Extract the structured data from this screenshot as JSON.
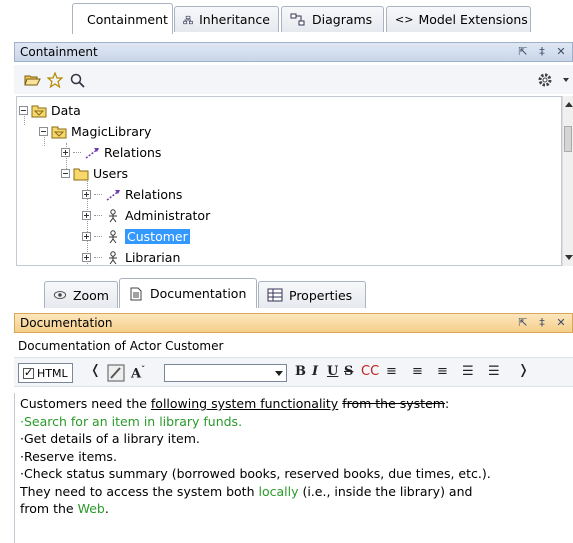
{
  "top_tabs": [
    {
      "label": "Containment",
      "icon": "containment-tree-icon",
      "active": true
    },
    {
      "label": "Inheritance",
      "icon": "inheritance-tree-icon",
      "active": false
    },
    {
      "label": "Diagrams",
      "icon": "diagrams-icon",
      "active": false
    },
    {
      "label": "Model Extensions",
      "icon": "model-extensions-icon",
      "active": false
    }
  ],
  "containment_panel": {
    "title": "Containment",
    "controls": [
      "restore-icon",
      "pin-icon",
      "close-icon"
    ]
  },
  "containment_toolbar": [
    "open-folder-icon",
    "favorite-star-icon",
    "search-icon",
    "settings-gear-icon"
  ],
  "tree": [
    {
      "label": "Data",
      "level": 0,
      "icon": "package-icon",
      "expanded": true
    },
    {
      "label": "MagicLibrary",
      "level": 1,
      "icon": "package-icon",
      "expanded": true
    },
    {
      "label": "Relations",
      "level": 2,
      "icon": "relations-icon",
      "expanded": false
    },
    {
      "label": "Users",
      "level": 2,
      "icon": "folder-icon",
      "expanded": true
    },
    {
      "label": "Relations",
      "level": 3,
      "icon": "relations-icon",
      "expanded": false
    },
    {
      "label": "Administrator",
      "level": 3,
      "icon": "actor-icon",
      "expanded": false
    },
    {
      "label": "Customer",
      "level": 3,
      "icon": "actor-icon",
      "expanded": false,
      "selected": true
    },
    {
      "label": "Librarian",
      "level": 3,
      "icon": "actor-icon",
      "expanded": false
    }
  ],
  "bottom_tabs": [
    {
      "label": "Zoom",
      "icon": "zoom-eye-icon",
      "active": false
    },
    {
      "label": "Documentation",
      "icon": "documentation-icon",
      "active": true
    },
    {
      "label": "Properties",
      "icon": "properties-icon",
      "active": false
    }
  ],
  "documentation_panel": {
    "title": "Documentation",
    "subtitle": "Documentation of Actor Customer",
    "html_label": "HTML",
    "html_checked": true,
    "font_value": ""
  },
  "doc_text": {
    "line1_a": "Customers need the ",
    "line1_underline": "following system functionality",
    "line1_b": " ",
    "line1_strike": "from the system",
    "line1_c": ":",
    "line2": "·Search for an item in library funds.",
    "line3": "·Get details of a library item.",
    "line4": "·Reserve items.",
    "line5": "·Check status summary (borrowed books, reserved books, due times, etc.).",
    "line6_a": "They need to access the system both ",
    "line6_green": "locally",
    "line6_b": " (i.e., inside the library) and",
    "line7_a": "from the ",
    "line7_green": "Web",
    "line7_b": "."
  },
  "colors": {
    "selection": "#3399ff",
    "doc_header": "#f5cf8a",
    "panel_header": "#c9d6e9",
    "green_text": "#2a9a2a"
  }
}
